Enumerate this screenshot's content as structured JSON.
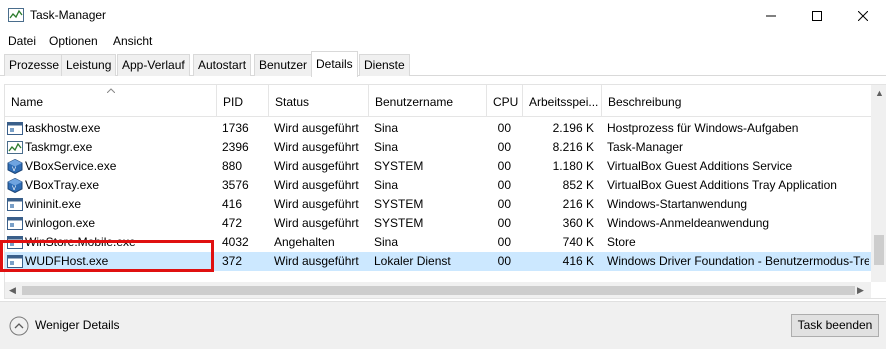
{
  "window": {
    "title": "Task-Manager"
  },
  "menu": [
    "Datei",
    "Optionen",
    "Ansicht"
  ],
  "tabs": [
    "Prozesse",
    "Leistung",
    "App-Verlauf",
    "Autostart",
    "Benutzer",
    "Details",
    "Dienste"
  ],
  "active_tab": "Details",
  "columns": {
    "name": "Name",
    "pid": "PID",
    "status": "Status",
    "user": "Benutzername",
    "cpu": "CPU",
    "memory": "Arbeitsspei...",
    "description": "Beschreibung"
  },
  "rows": [
    {
      "name": "taskhostw.exe",
      "pid": "1736",
      "status": "Wird ausgeführt",
      "user": "Sina",
      "cpu": "00",
      "memory": "2.196 K",
      "description": "Hostprozess für Windows-Aufgaben",
      "icon": "window-process-icon"
    },
    {
      "name": "Taskmgr.exe",
      "pid": "2396",
      "status": "Wird ausgeführt",
      "user": "Sina",
      "cpu": "00",
      "memory": "8.216 K",
      "description": "Task-Manager",
      "icon": "task-manager-icon"
    },
    {
      "name": "VBoxService.exe",
      "pid": "880",
      "status": "Wird ausgeführt",
      "user": "SYSTEM",
      "cpu": "00",
      "memory": "1.180 K",
      "description": "VirtualBox Guest Additions Service",
      "icon": "virtualbox-icon"
    },
    {
      "name": "VBoxTray.exe",
      "pid": "3576",
      "status": "Wird ausgeführt",
      "user": "Sina",
      "cpu": "00",
      "memory": "852 K",
      "description": "VirtualBox Guest Additions Tray Application",
      "icon": "virtualbox-icon"
    },
    {
      "name": "wininit.exe",
      "pid": "416",
      "status": "Wird ausgeführt",
      "user": "SYSTEM",
      "cpu": "00",
      "memory": "216 K",
      "description": "Windows-Startanwendung",
      "icon": "window-process-icon"
    },
    {
      "name": "winlogon.exe",
      "pid": "472",
      "status": "Wird ausgeführt",
      "user": "SYSTEM",
      "cpu": "00",
      "memory": "360 K",
      "description": "Windows-Anmeldeanwendung",
      "icon": "window-process-icon"
    },
    {
      "name": "WinStore.Mobile.exe",
      "pid": "4032",
      "status": "Angehalten",
      "user": "Sina",
      "cpu": "00",
      "memory": "740 K",
      "description": "Store",
      "icon": "window-process-icon"
    },
    {
      "name": "WUDFHost.exe",
      "pid": "372",
      "status": "Wird ausgeführt",
      "user": "Lokaler Dienst",
      "cpu": "00",
      "memory": "416 K",
      "description": "Windows Driver Foundation - Benutzermodus-Tre",
      "icon": "window-process-icon",
      "selected": true
    }
  ],
  "footer": {
    "fewer_details": "Weniger Details",
    "end_task": "Task beenden"
  },
  "colors": {
    "selection": "#cce8ff",
    "highlight": "#e01010"
  }
}
